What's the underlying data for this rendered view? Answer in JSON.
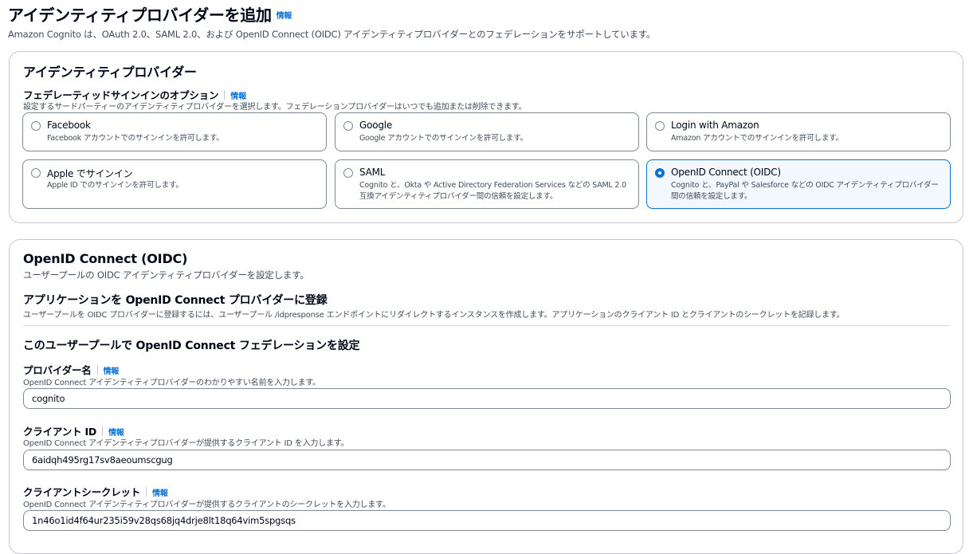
{
  "page": {
    "title": "アイデンティティプロバイダーを追加",
    "info": "情報",
    "description": "Amazon Cognito は、OAuth 2.0、SAML 2.0、および OpenID Connect (OIDC) アイデンティティプロバイダーとのフェデレーションをサポートしています。"
  },
  "idp": {
    "heading": "アイデンティティプロバイダー",
    "option_label": "フェデレーティッドサインインのオプション",
    "info": "情報",
    "option_desc": "設定するサードパーティーのアイデンティティプロバイダーを選択します。フェデレーションプロバイダーはいつでも追加または削除できます。",
    "options": [
      {
        "title": "Facebook",
        "desc": "Facebook アカウントでのサインインを許可します。",
        "selected": false
      },
      {
        "title": "Google",
        "desc": "Google アカウントでのサインインを許可します。",
        "selected": false
      },
      {
        "title": "Login with Amazon",
        "desc": "Amazon アカウントでのサインインを許可します。",
        "selected": false
      },
      {
        "title": "Apple でサインイン",
        "desc": "Apple ID でのサインインを許可します。",
        "selected": false
      },
      {
        "title": "SAML",
        "desc": "Cognito と、Okta や Active Directory Federation Services などの SAML 2.0 互換アイデンティティプロバイダー間の信頼を設定します。",
        "selected": false
      },
      {
        "title": "OpenID Connect (OIDC)",
        "desc": "Cognito と、PayPal や Salesforce などの OIDC アイデンティティプロバイダー間の信頼を設定します。",
        "selected": true
      }
    ]
  },
  "oidc": {
    "heading": "OpenID Connect (OIDC)",
    "heading_desc": "ユーザープールの OIDC アイデンティティプロバイダーを設定します。",
    "register_heading": "アプリケーションを OpenID Connect プロバイダーに登録",
    "register_desc": "ユーザープールを OIDC プロバイダーに登録するには、ユーザープール /idpresponse エンドポイントにリダイレクトするインスタンスを作成します。アプリケーションのクライアント ID とクライアントのシークレットを記録します。",
    "configure_heading": "このユーザープールで OpenID Connect フェデレーションを設定",
    "fields": {
      "provider_name": {
        "label": "プロバイダー名",
        "info": "情報",
        "desc": "OpenID Connect アイデンティティプロバイダーのわかりやすい名前を入力します。",
        "value": "cognito"
      },
      "client_id": {
        "label": "クライアント ID",
        "info": "情報",
        "desc": "OpenID Connect アイデンティティプロバイダーが提供するクライアント ID を入力します。",
        "value": "6aidqh495rg17sv8aeoumscgug"
      },
      "client_secret": {
        "label": "クライアントシークレット",
        "info": "情報",
        "desc": "OpenID Connect アイデンティティプロバイダーが提供するクライアントのシークレットを入力します。",
        "value": "1n46o1id4f64ur235i59v28qs68jq4drje8lt18q64vim5spgsqs"
      }
    }
  }
}
